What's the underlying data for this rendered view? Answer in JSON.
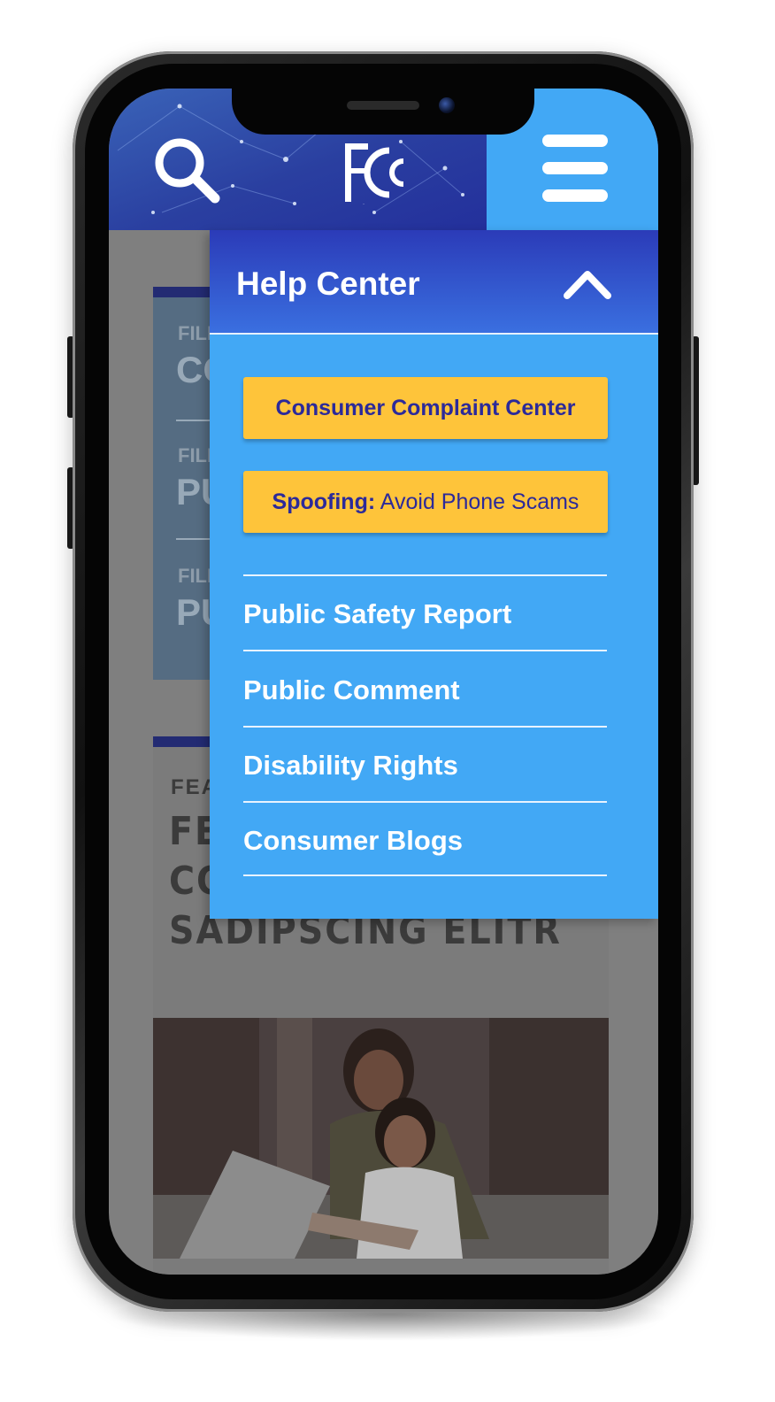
{
  "header": {
    "logo_text": "FCC",
    "search_icon": "search-icon",
    "menu_icon": "hamburger-menu-icon"
  },
  "background_page": {
    "card1": {
      "rows": [
        {
          "label": "FILE",
          "title": "CO"
        },
        {
          "label": "FILE",
          "title": "PU"
        },
        {
          "label": "FILE",
          "title": "PU"
        }
      ]
    },
    "card2": {
      "kicker": "FEAT",
      "headline": "FEA IPS CONSETETUR SADIPSCING ELITR"
    }
  },
  "help_menu": {
    "title": "Help Center",
    "toggle_icon": "chevron-up-icon",
    "primary_button": "Consumer Complaint Center",
    "secondary_button": {
      "bold": "Spoofing:",
      "text": "Avoid Phone Scams"
    },
    "links": [
      "Public Safety Report",
      "Public Comment",
      "Disability Rights",
      "Consumer Blogs"
    ]
  },
  "colors": {
    "menu_blue": "#42a8f5",
    "header_navy": "#2a3fa0",
    "cta_yellow": "#fec43a",
    "cta_text": "#2c2a9a"
  }
}
